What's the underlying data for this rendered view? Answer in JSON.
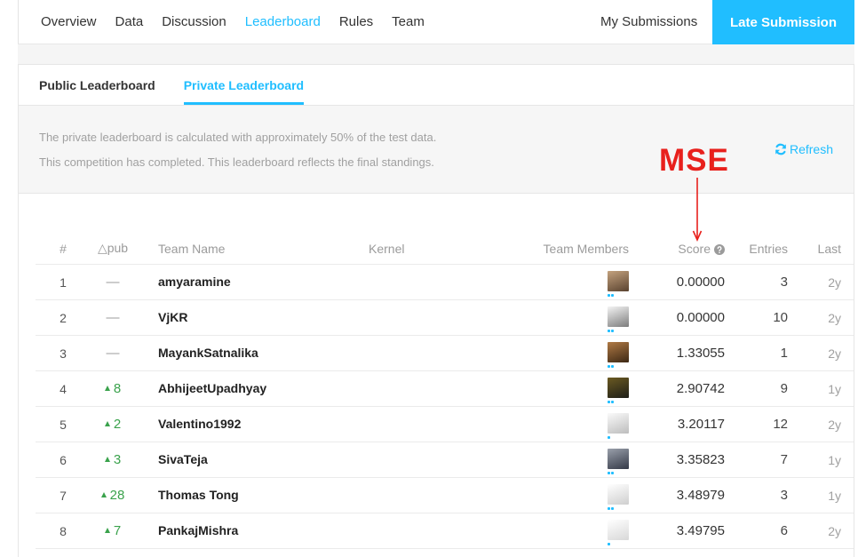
{
  "nav": {
    "tabs": [
      {
        "label": "Overview"
      },
      {
        "label": "Data"
      },
      {
        "label": "Discussion"
      },
      {
        "label": "Leaderboard",
        "active": true
      },
      {
        "label": "Rules"
      },
      {
        "label": "Team"
      }
    ],
    "my_submissions": "My Submissions",
    "late_submission": "Late Submission"
  },
  "leaderboard_tabs": [
    {
      "label": "Public Leaderboard"
    },
    {
      "label": "Private Leaderboard",
      "active": true
    }
  ],
  "info": {
    "line1": "The private leaderboard is calculated with approximately 50% of the test data.",
    "line2": "This competition has completed. This leaderboard reflects the final standings.",
    "refresh": "Refresh"
  },
  "table": {
    "headers": {
      "rank": "#",
      "delta": "△pub",
      "team": "Team Name",
      "kernel": "Kernel",
      "members": "Team Members",
      "score": "Score",
      "entries": "Entries",
      "last": "Last"
    },
    "rows": [
      {
        "rank": "1",
        "delta": "—",
        "team": "amyaramine",
        "avatar": [
          "#c4a27e",
          "#5a4330"
        ],
        "tier_dots": 2,
        "score": "0.00000",
        "entries": "3",
        "last": "2y"
      },
      {
        "rank": "2",
        "delta": "—",
        "team": "VjKR",
        "avatar": [
          "#f4f4f4",
          "#7d7d7d"
        ],
        "tier_dots": 2,
        "score": "0.00000",
        "entries": "10",
        "last": "2y"
      },
      {
        "rank": "3",
        "delta": "—",
        "team": "MayankSatnalika",
        "avatar": [
          "#b07a45",
          "#3d2814"
        ],
        "tier_dots": 2,
        "score": "1.33055",
        "entries": "1",
        "last": "2y"
      },
      {
        "rank": "4",
        "delta": "8",
        "delta_icon": "rank-up-icon",
        "team": "AbhijeetUpadhyay",
        "avatar": [
          "#6b5a22",
          "#1e1e18"
        ],
        "tier_dots": 2,
        "score": "2.90742",
        "entries": "9",
        "last": "1y"
      },
      {
        "rank": "5",
        "delta": "2",
        "delta_icon": "rank-up-icon",
        "team": "Valentino1992",
        "avatar": [
          "#fafafa",
          "#bdbdbd"
        ],
        "tier_dots": 1,
        "score": "3.20117",
        "entries": "12",
        "last": "2y"
      },
      {
        "rank": "6",
        "delta": "3",
        "delta_icon": "rank-up-icon",
        "team": "SivaTeja",
        "avatar": [
          "#9aa0ab",
          "#343947"
        ],
        "tier_dots": 2,
        "score": "3.35823",
        "entries": "7",
        "last": "1y"
      },
      {
        "rank": "7",
        "delta": "28",
        "delta_icon": "rank-up-icon",
        "team": "Thomas Tong",
        "avatar": [
          "#ffffff",
          "#cfcfcf"
        ],
        "tier_dots": 2,
        "score": "3.48979",
        "entries": "3",
        "last": "1y"
      },
      {
        "rank": "8",
        "delta": "7",
        "delta_icon": "rank-up-icon",
        "team": "PankajMishra",
        "avatar": [
          "#ffffff",
          "#d8d8d8"
        ],
        "tier_dots": 1,
        "score": "3.49795",
        "entries": "6",
        "last": "2y"
      }
    ]
  },
  "annotation": {
    "label": "MSE",
    "color": "#e8201c"
  },
  "icons": {
    "refresh": "refresh-icon",
    "score_help": "help-circle-icon",
    "rank_change": "rank-up-icon"
  },
  "colors": {
    "accent": "#20beff",
    "rank_up": "#3aa24c",
    "muted_text": "#a0a0a0"
  }
}
